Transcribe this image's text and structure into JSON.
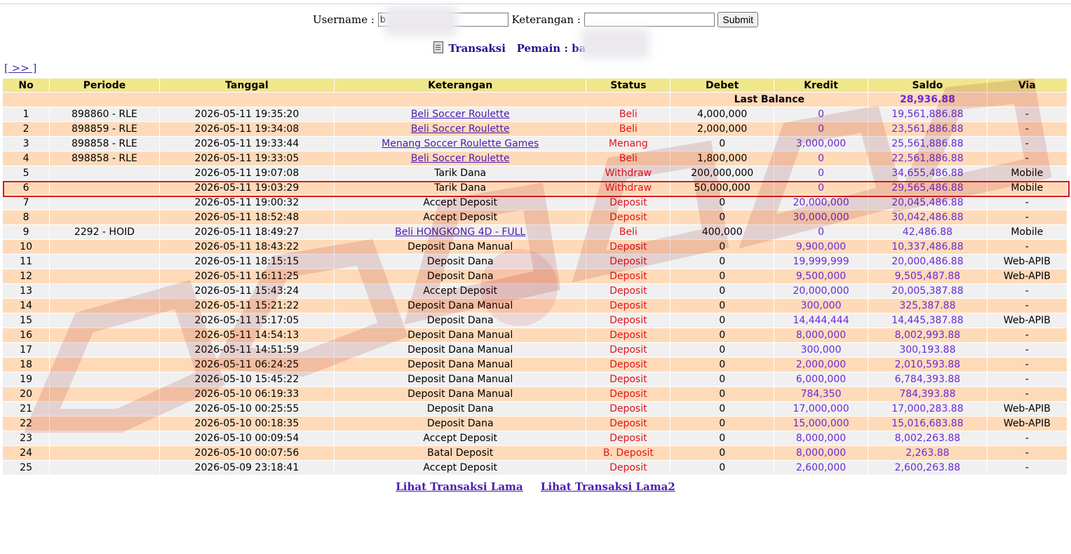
{
  "search": {
    "username_label": "Username :",
    "username_value": "b",
    "keterangan_label": "Keterangan :",
    "keterangan_value": "",
    "submit_label": "Submit"
  },
  "title": {
    "transaksi": "Transaksi",
    "pemain": "Pemain : ba"
  },
  "nav": {
    "next": "[ >> ]"
  },
  "columns": [
    "No",
    "Periode",
    "Tanggal",
    "Keterangan",
    "Status",
    "Debet",
    "Kredit",
    "Saldo",
    "Via"
  ],
  "last_balance": {
    "label": "Last Balance",
    "value": "28,936.88"
  },
  "rows": [
    {
      "no": "1",
      "periode": "898860 - RLE",
      "tanggal": "2026-05-11 19:35:20",
      "keterangan": "Beli Soccer Roulette",
      "link": true,
      "status": "Beli",
      "debet": "4,000,000",
      "kredit": "0",
      "saldo": "19,561,886.88",
      "via": "-"
    },
    {
      "no": "2",
      "periode": "898859 - RLE",
      "tanggal": "2026-05-11 19:34:08",
      "keterangan": "Beli Soccer Roulette",
      "link": true,
      "status": "Beli",
      "debet": "2,000,000",
      "kredit": "0",
      "saldo": "23,561,886.88",
      "via": "-"
    },
    {
      "no": "3",
      "periode": "898858 - RLE",
      "tanggal": "2026-05-11 19:33:44",
      "keterangan": "Menang Soccer Roulette Games",
      "link": true,
      "status": "Menang",
      "debet": "0",
      "kredit": "3,000,000",
      "saldo": "25,561,886.88",
      "via": "-"
    },
    {
      "no": "4",
      "periode": "898858 - RLE",
      "tanggal": "2026-05-11 19:33:05",
      "keterangan": "Beli Soccer Roulette",
      "link": true,
      "status": "Beli",
      "debet": "1,800,000",
      "kredit": "0",
      "saldo": "22,561,886.88",
      "via": "-"
    },
    {
      "no": "5",
      "periode": "",
      "tanggal": "2026-05-11 19:07:08",
      "keterangan": "Tarik Dana",
      "link": false,
      "status": "Withdraw",
      "debet": "200,000,000",
      "kredit": "0",
      "saldo": "34,655,486.88",
      "via": "Mobile"
    },
    {
      "no": "6",
      "periode": "",
      "tanggal": "2026-05-11 19:03:29",
      "keterangan": "Tarik Dana",
      "link": false,
      "status": "Withdraw",
      "debet": "50,000,000",
      "kredit": "0",
      "saldo": "29,565,486.88",
      "via": "Mobile"
    },
    {
      "no": "7",
      "periode": "",
      "tanggal": "2026-05-11 19:00:32",
      "keterangan": "Accept Deposit",
      "link": false,
      "status": "Deposit",
      "debet": "0",
      "kredit": "20,000,000",
      "saldo": "20,045,486.88",
      "via": "-"
    },
    {
      "no": "8",
      "periode": "",
      "tanggal": "2026-05-11 18:52:48",
      "keterangan": "Accept Deposit",
      "link": false,
      "status": "Deposit",
      "debet": "0",
      "kredit": "30,000,000",
      "saldo": "30,042,486.88",
      "via": "-"
    },
    {
      "no": "9",
      "periode": "2292 - HOID",
      "tanggal": "2026-05-11 18:49:27",
      "keterangan": "Beli HONGKONG 4D - FULL",
      "link": true,
      "status": "Beli",
      "debet": "400,000",
      "kredit": "0",
      "saldo": "42,486.88",
      "via": "Mobile"
    },
    {
      "no": "10",
      "periode": "",
      "tanggal": "2026-05-11 18:43:22",
      "keterangan": "Deposit Dana Manual",
      "link": false,
      "status": "Deposit",
      "debet": "0",
      "kredit": "9,900,000",
      "saldo": "10,337,486.88",
      "via": "-"
    },
    {
      "no": "11",
      "periode": "",
      "tanggal": "2026-05-11 18:15:15",
      "keterangan": "Deposit Dana",
      "link": false,
      "status": "Deposit",
      "debet": "0",
      "kredit": "19,999,999",
      "saldo": "20,000,486.88",
      "via": "Web-APIB"
    },
    {
      "no": "12",
      "periode": "",
      "tanggal": "2026-05-11 16:11:25",
      "keterangan": "Deposit Dana",
      "link": false,
      "status": "Deposit",
      "debet": "0",
      "kredit": "9,500,000",
      "saldo": "9,505,487.88",
      "via": "Web-APIB"
    },
    {
      "no": "13",
      "periode": "",
      "tanggal": "2026-05-11 15:43:24",
      "keterangan": "Accept Deposit",
      "link": false,
      "status": "Deposit",
      "debet": "0",
      "kredit": "20,000,000",
      "saldo": "20,005,387.88",
      "via": "-"
    },
    {
      "no": "14",
      "periode": "",
      "tanggal": "2026-05-11 15:21:22",
      "keterangan": "Deposit Dana Manual",
      "link": false,
      "status": "Deposit",
      "debet": "0",
      "kredit": "300,000",
      "saldo": "325,387.88",
      "via": "-"
    },
    {
      "no": "15",
      "periode": "",
      "tanggal": "2026-05-11 15:17:05",
      "keterangan": "Deposit Dana",
      "link": false,
      "status": "Deposit",
      "debet": "0",
      "kredit": "14,444,444",
      "saldo": "14,445,387.88",
      "via": "Web-APIB"
    },
    {
      "no": "16",
      "periode": "",
      "tanggal": "2026-05-11 14:54:13",
      "keterangan": "Deposit Dana Manual",
      "link": false,
      "status": "Deposit",
      "debet": "0",
      "kredit": "8,000,000",
      "saldo": "8,002,993.88",
      "via": "-"
    },
    {
      "no": "17",
      "periode": "",
      "tanggal": "2026-05-11 14:51:59",
      "keterangan": "Deposit Dana Manual",
      "link": false,
      "status": "Deposit",
      "debet": "0",
      "kredit": "300,000",
      "saldo": "300,193.88",
      "via": "-"
    },
    {
      "no": "18",
      "periode": "",
      "tanggal": "2026-05-11 06:24:25",
      "keterangan": "Deposit Dana Manual",
      "link": false,
      "status": "Deposit",
      "debet": "0",
      "kredit": "2,000,000",
      "saldo": "2,010,593.88",
      "via": "-"
    },
    {
      "no": "19",
      "periode": "",
      "tanggal": "2026-05-10 15:45:22",
      "keterangan": "Deposit Dana Manual",
      "link": false,
      "status": "Deposit",
      "debet": "0",
      "kredit": "6,000,000",
      "saldo": "6,784,393.88",
      "via": "-"
    },
    {
      "no": "20",
      "periode": "",
      "tanggal": "2026-05-10 06:19:33",
      "keterangan": "Deposit Dana Manual",
      "link": false,
      "status": "Deposit",
      "debet": "0",
      "kredit": "784,350",
      "saldo": "784,393.88",
      "via": "-"
    },
    {
      "no": "21",
      "periode": "",
      "tanggal": "2026-05-10 00:25:55",
      "keterangan": "Deposit Dana",
      "link": false,
      "status": "Deposit",
      "debet": "0",
      "kredit": "17,000,000",
      "saldo": "17,000,283.88",
      "via": "Web-APIB"
    },
    {
      "no": "22",
      "periode": "",
      "tanggal": "2026-05-10 00:18:35",
      "keterangan": "Deposit Dana",
      "link": false,
      "status": "Deposit",
      "debet": "0",
      "kredit": "15,000,000",
      "saldo": "15,016,683.88",
      "via": "Web-APIB"
    },
    {
      "no": "23",
      "periode": "",
      "tanggal": "2026-05-10 00:09:54",
      "keterangan": "Accept Deposit",
      "link": false,
      "status": "Deposit",
      "debet": "0",
      "kredit": "8,000,000",
      "saldo": "8,002,263.88",
      "via": "-"
    },
    {
      "no": "24",
      "periode": "",
      "tanggal": "2026-05-10 00:07:56",
      "keterangan": "Batal Deposit",
      "link": false,
      "status": "B. Deposit",
      "debet": "0",
      "kredit": "8,000,000",
      "saldo": "2,263.88",
      "via": "-"
    },
    {
      "no": "25",
      "periode": "",
      "tanggal": "2026-05-09 23:18:41",
      "keterangan": "Accept Deposit",
      "link": false,
      "status": "Deposit",
      "debet": "0",
      "kredit": "2,600,000",
      "saldo": "2,600,263.88",
      "via": "-"
    }
  ],
  "highlighted_row": 6,
  "footer": {
    "link1": "Lihat Transaksi Lama",
    "link2": "Lihat Transaksi Lama2"
  },
  "colors": {
    "header_bg": "#f0e68c",
    "row_odd": "#f0f0f0",
    "row_even": "#ffdab9",
    "status_red": "#e0141e",
    "kredit_purple": "#6a2bd1",
    "link_purple": "#4b1bb0",
    "highlight_border": "#d61a1a"
  }
}
